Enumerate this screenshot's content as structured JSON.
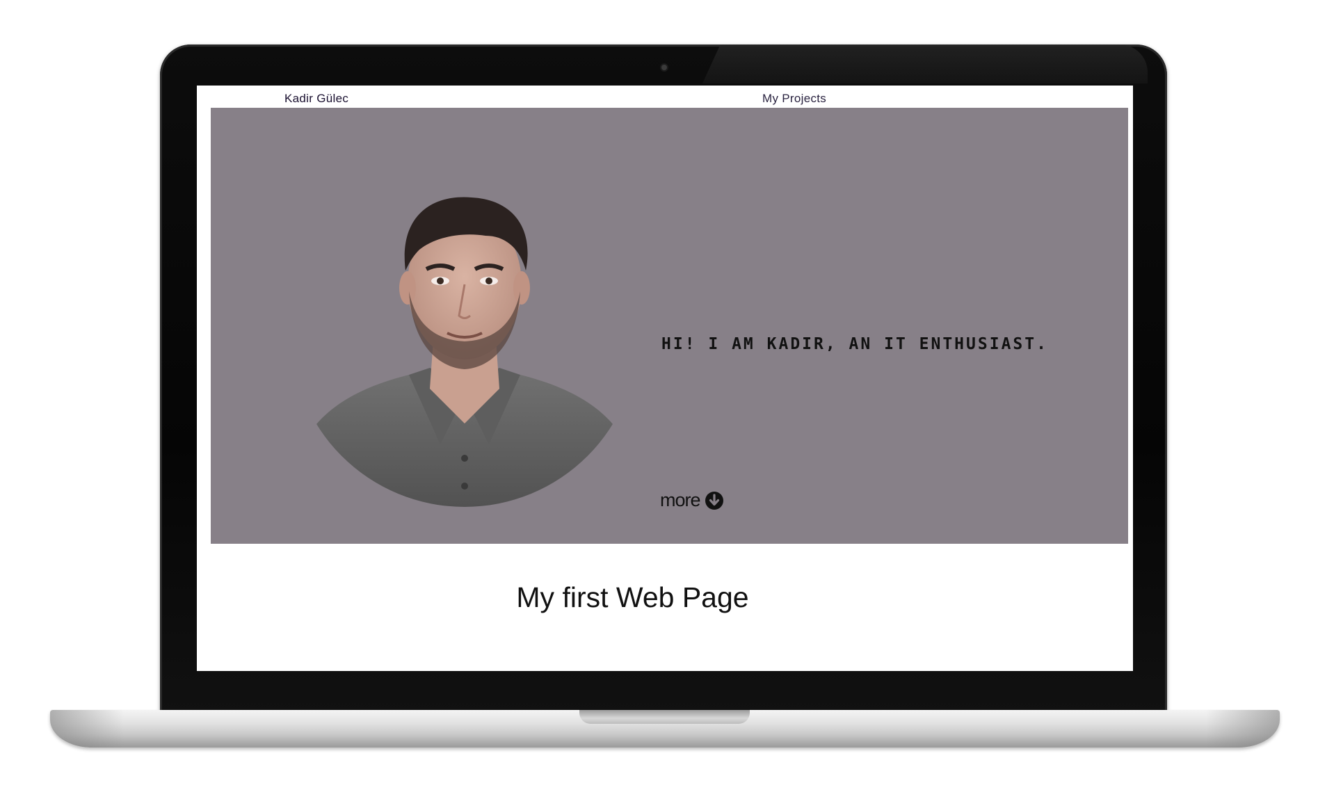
{
  "nav": {
    "brand": "Kadir Gülec",
    "projects_link": "My Projects"
  },
  "hero": {
    "tagline": "HI! I AM KADIR, AN IT ENTHUSIAST.",
    "more_label": "more",
    "more_icon": "arrow-down-circle-icon",
    "background_color": "#878088"
  },
  "footer": {
    "title": "My first Web Page"
  }
}
